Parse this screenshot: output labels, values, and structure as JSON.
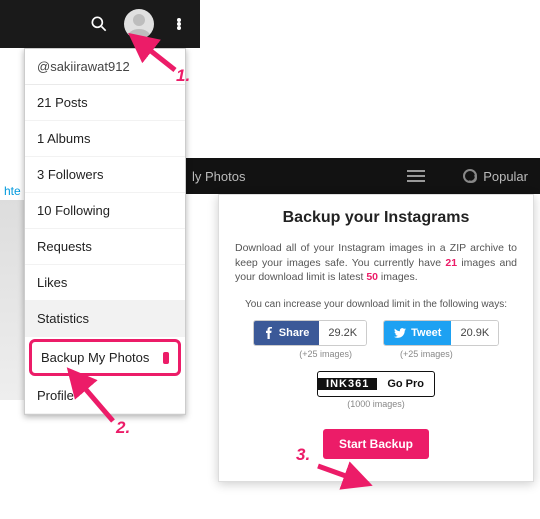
{
  "topbar": {
    "search_icon": "search",
    "avatar": "user-avatar",
    "overflow": "more"
  },
  "menu": {
    "username": "@sakiirawat912",
    "items": [
      {
        "label": "21 Posts"
      },
      {
        "label": "1 Albums"
      },
      {
        "label": "3 Followers"
      },
      {
        "label": "10 Following"
      },
      {
        "label": "Requests"
      },
      {
        "label": "Likes"
      },
      {
        "label": "Statistics"
      },
      {
        "label": "Backup My Photos"
      },
      {
        "label": "Profile"
      }
    ]
  },
  "pagebg": {
    "link": "hte",
    "my_photos": "ly Photos",
    "popular": "Popular"
  },
  "modal": {
    "title": "Backup your Instagrams",
    "desc_pre": "Download all of your Instagram images in a ZIP archive to keep your images safe. You currently have ",
    "count1": "21",
    "desc_mid": " images and your download limit is latest ",
    "count2": "50",
    "desc_post": " images.",
    "increase": "You can increase your download limit in the following ways:",
    "share": {
      "fb_label": "Share",
      "fb_count": "29.2K",
      "fb_bonus": "(+25 images)",
      "tw_label": "Tweet",
      "tw_count": "20.9K",
      "tw_bonus": "(+25 images)"
    },
    "gopro": {
      "brand": "INK361",
      "label": "Go Pro",
      "bonus": "(1000 images)"
    },
    "start": "Start Backup"
  },
  "annotations": {
    "n1": "1.",
    "n2": "2.",
    "n3": "3."
  }
}
